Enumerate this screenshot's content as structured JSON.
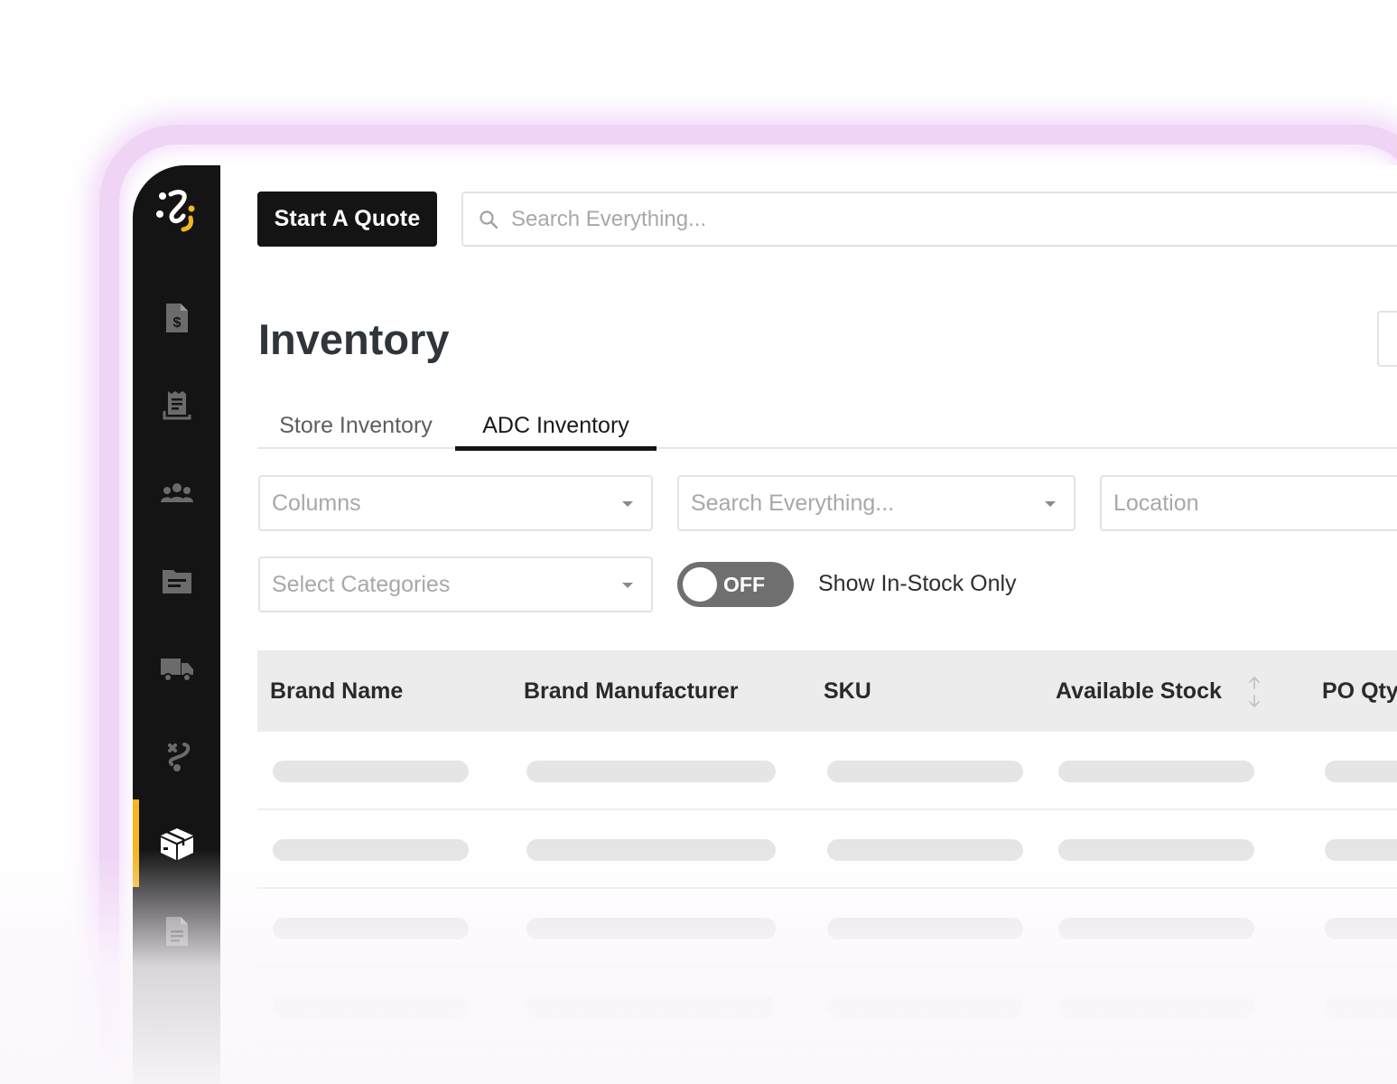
{
  "header": {
    "quote_button": "Start A Quote",
    "search_placeholder": "Search Everything..."
  },
  "page": {
    "title": "Inventory"
  },
  "tabs": [
    {
      "label": "Store Inventory",
      "active": false
    },
    {
      "label": "ADC Inventory",
      "active": true
    }
  ],
  "filters": {
    "columns_placeholder": "Columns",
    "search_placeholder": "Search Everything...",
    "location_placeholder": "Location",
    "categories_placeholder": "Select Categories",
    "toggle_state": "OFF",
    "toggle_label": "Show In-Stock Only"
  },
  "table": {
    "columns": [
      "Brand Name",
      "Brand Manufacturer",
      "SKU",
      "Available Stock",
      "PO Qty"
    ],
    "rows_loading": 3
  },
  "sidebar": {
    "items": [
      {
        "icon": "invoice-dollar-icon",
        "active": false
      },
      {
        "icon": "receipt-icon",
        "active": false
      },
      {
        "icon": "users-group-icon",
        "active": false
      },
      {
        "icon": "folder-icon",
        "active": false
      },
      {
        "icon": "truck-icon",
        "active": false
      },
      {
        "icon": "route-icon",
        "active": false
      },
      {
        "icon": "box-icon",
        "active": true
      },
      {
        "icon": "document-icon",
        "active": false
      }
    ]
  },
  "colors": {
    "accent": "#f5b51e",
    "sidebar_bg": "#141414",
    "glow": "#e0a6ef"
  }
}
